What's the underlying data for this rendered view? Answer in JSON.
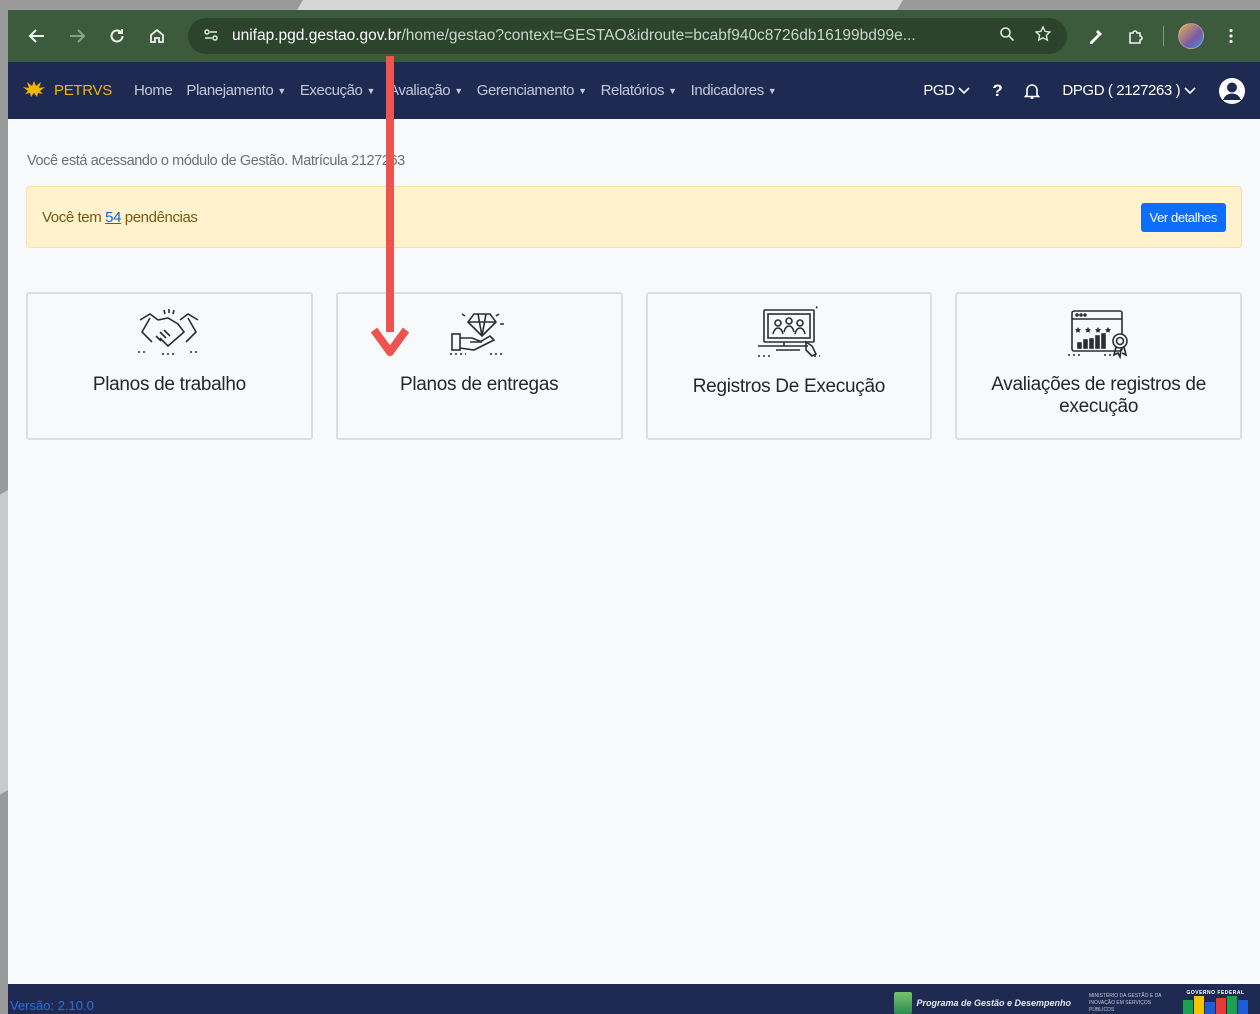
{
  "browser": {
    "url_host": "unifap.pgd.gestao.gov.br",
    "url_rest": "/home/gestao?context=GESTAO&idroute=bcabf940c8726db16199bd99e..."
  },
  "appbar": {
    "brand": "PETRVS",
    "menu": [
      {
        "label": "Home",
        "caret": false
      },
      {
        "label": "Planejamento",
        "caret": true
      },
      {
        "label": "Execução",
        "caret": true
      },
      {
        "label": "Avaliação",
        "caret": true
      },
      {
        "label": "Gerenciamento",
        "caret": true
      },
      {
        "label": "Relatórios",
        "caret": true
      },
      {
        "label": "Indicadores",
        "caret": true
      }
    ],
    "context": "PGD",
    "help": "?",
    "user_label": "DPGD ( 2127263 )"
  },
  "main": {
    "access_text": "Você está acessando o módulo de Gestão. Matrícula 2127263",
    "alert": {
      "prefix": "Você tem",
      "count": "54",
      "suffix": "pendências",
      "button": "Ver detalhes"
    },
    "cards": [
      {
        "label": "Planos de trabalho",
        "icon": "handshake-icon"
      },
      {
        "label": "Planos de entregas",
        "icon": "diamond-hand-icon"
      },
      {
        "label": "Registros De Execução",
        "icon": "monitor-team-icon"
      },
      {
        "label": "Avaliações de registros de execução",
        "icon": "rating-chart-icon"
      }
    ]
  },
  "footer": {
    "version": "Versão: 2.10.0",
    "program": "Programa de Gestão e Desempenho",
    "ministry": "MINISTÉRIO DA GESTÃO E DA INOVAÇÃO EM SERVIÇOS PÚBLICOS",
    "gov": "GOVERNO FEDERAL"
  },
  "annotation": {
    "color": "#ef5350"
  }
}
